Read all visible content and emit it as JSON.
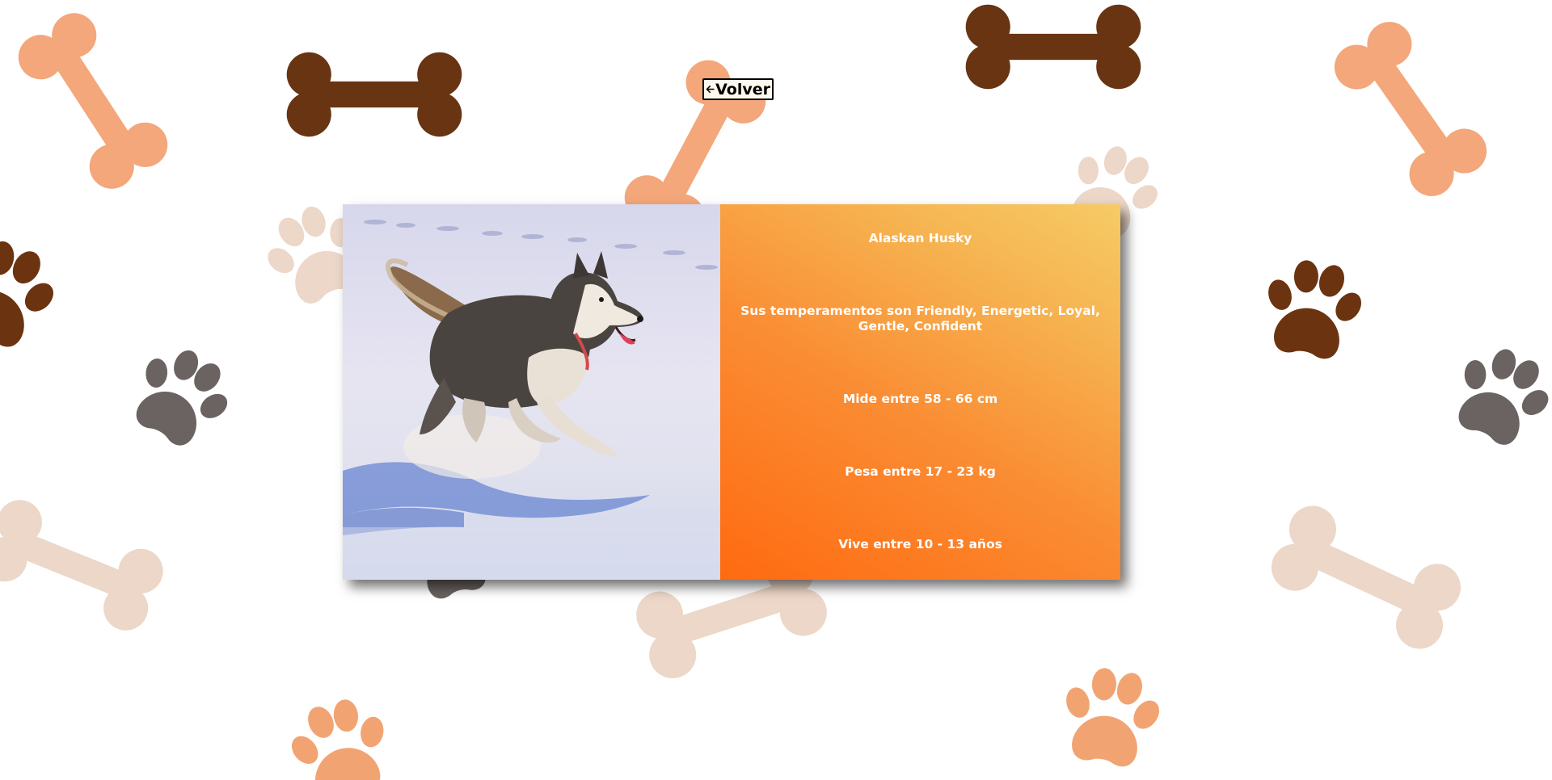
{
  "navigation": {
    "back_label": "Volver",
    "back_icon": "arrow-left-icon"
  },
  "breed": {
    "name": "Alaskan Husky",
    "temperament": "Sus temperamentos son Friendly, Energetic, Loyal, Gentle, Confident",
    "height": "Mide entre 58 - 66 cm",
    "weight": "Pesa entre 17 - 23 kg",
    "life_span": "Vive entre 10 - 13 años",
    "image_subject": "husky-running-in-snow"
  },
  "theme": {
    "page_background": "#ffffff",
    "card_gradient_start": "#ff6a10",
    "card_gradient_end": "#f6cb66",
    "text_color": "#ffffff",
    "bone_dark": "#683412",
    "bone_orange": "#f3a77a",
    "bone_light": "#ecd7c8",
    "paw_gray": "#6a6361",
    "paw_dark": "#6b3310",
    "paw_orange": "#f1a472"
  }
}
